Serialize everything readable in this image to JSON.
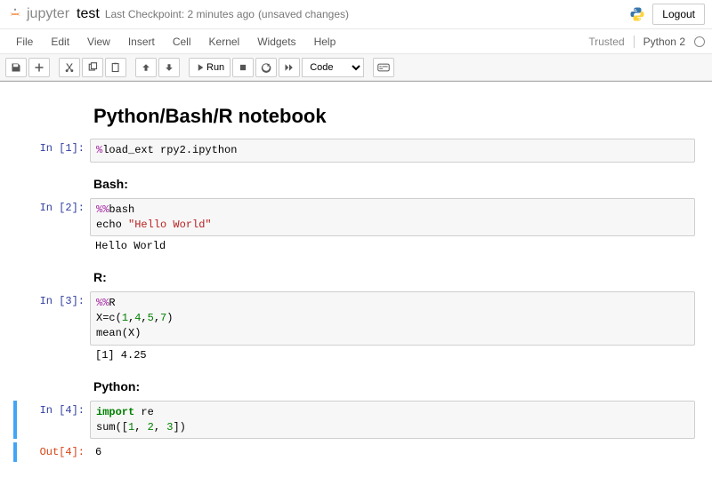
{
  "header": {
    "logo_text": "jupyter",
    "notebook_name": "test",
    "checkpoint": "Last Checkpoint: 2 minutes ago",
    "unsaved": "(unsaved changes)",
    "logout": "Logout"
  },
  "menubar": {
    "items": [
      "File",
      "Edit",
      "View",
      "Insert",
      "Cell",
      "Kernel",
      "Widgets",
      "Help"
    ],
    "trusted": "Trusted",
    "kernel": "Python 2"
  },
  "toolbar": {
    "run_label": "Run",
    "celltype": "Code"
  },
  "title": "Python/Bash/R notebook",
  "sections": {
    "bash": "Bash:",
    "r": "R:",
    "python": "Python:"
  },
  "cells": {
    "c1": {
      "prompt": "In [1]:",
      "magic": "%",
      "rest": "load_ext rpy2.ipython"
    },
    "c2": {
      "prompt": "In [2]:",
      "line1_magic": "%%",
      "line1_rest": "bash",
      "line2a": "echo ",
      "line2_str": "\"Hello World\"",
      "output": "Hello World"
    },
    "c3": {
      "prompt": "In [3]:",
      "line1_magic": "%%",
      "line1_rest": "R",
      "line2a": "X=c(",
      "n1": "1",
      "c": ",",
      "n2": "4",
      "n3": "5",
      "n4": "7",
      "line2b": ")",
      "line3": "mean(X)",
      "output": "[1] 4.25"
    },
    "c4": {
      "prompt": "In [4]:",
      "kw": "import",
      "mod": " re",
      "line2": "sum([",
      "a1": "1",
      "cc": ", ",
      "a2": "2",
      "a3": "3",
      "line2b": "])",
      "out_prompt": "Out[4]:",
      "output": "6"
    }
  }
}
